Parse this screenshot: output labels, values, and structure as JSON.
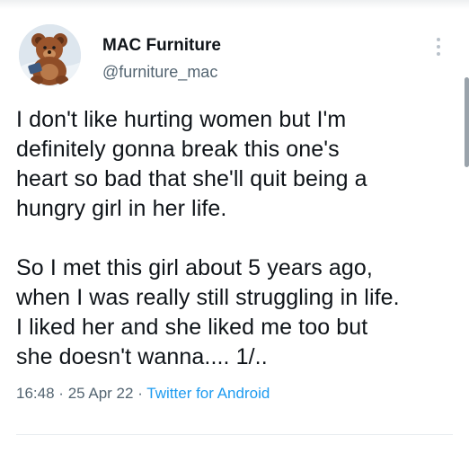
{
  "tweet": {
    "display_name": "MAC Furniture",
    "handle": "@furniture_mac",
    "text": "I don't like hurting women but I'm\ndefinitely gonna break this one's\nheart so bad that she'll quit being a\nhungry girl in her life.\n\nSo I met this girl about 5 years ago,\nwhen I was really still struggling in life.\nI liked her and she liked me too but\nshe doesn't wanna.... 1/..",
    "time": "16:48",
    "separator": "·",
    "date": "25 Apr 22",
    "source": "Twitter for Android"
  },
  "icons": {
    "avatar": "avatar-teddy-bear",
    "more": "more-vertical-icon"
  },
  "colors": {
    "text": "#0f1419",
    "secondary": "#536471",
    "link": "#1d9bf0",
    "divider": "#e7ecef"
  }
}
